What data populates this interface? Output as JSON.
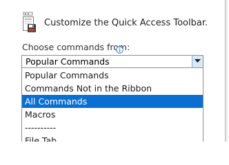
{
  "header": {
    "title": "Customize the Quick Access Toolbar.",
    "icon": "quick-access-toolbar-icon"
  },
  "commands": {
    "label": "Choose commands from:",
    "info_icon": "info-icon",
    "selected_value": "Popular Commands",
    "options": [
      "Popular Commands",
      "Commands Not in the Ribbon",
      "All Commands",
      "Macros",
      "----------",
      "File Tab"
    ],
    "highlighted_option": "All Commands"
  },
  "colors": {
    "highlight": "#0a6fd1",
    "dropdown_button": "#dbe9f7",
    "border": "#8e8e8e"
  }
}
